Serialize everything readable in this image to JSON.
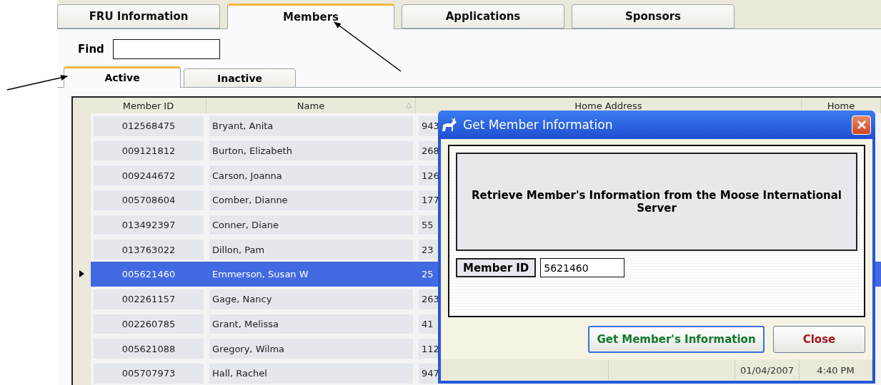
{
  "main_tabs": [
    {
      "label": "FRU Information",
      "selected": false
    },
    {
      "label": "Members",
      "selected": true
    },
    {
      "label": "Applications",
      "selected": false
    },
    {
      "label": "Sponsors",
      "selected": false
    }
  ],
  "find": {
    "label": "Find"
  },
  "sub_tabs": [
    {
      "label": "Active",
      "selected": true
    },
    {
      "label": "Inactive",
      "selected": false
    }
  ],
  "table": {
    "columns": [
      {
        "label": "Member ID",
        "sorted": false
      },
      {
        "label": "Name",
        "sorted": true
      },
      {
        "label": "Home Address",
        "sorted": false
      },
      {
        "label": "Home",
        "sorted": false
      }
    ],
    "rows": [
      {
        "member_id": "012568475",
        "name": "Bryant, Anita",
        "address": "943",
        "selected": false
      },
      {
        "member_id": "009121812",
        "name": "Burton, Elizabeth",
        "address": "268",
        "selected": false
      },
      {
        "member_id": "009244672",
        "name": "Carson, Joanna",
        "address": "126",
        "selected": false
      },
      {
        "member_id": "005708604",
        "name": "Comber, Dianne",
        "address": "177",
        "selected": false
      },
      {
        "member_id": "013492397",
        "name": "Conner, Diane",
        "address": "55",
        "selected": false
      },
      {
        "member_id": "013763022",
        "name": "Dillon, Pam",
        "address": "23",
        "selected": false
      },
      {
        "member_id": "005621460",
        "name": "Emmerson, Susan W",
        "address": "25",
        "selected": true
      },
      {
        "member_id": "002261157",
        "name": "Gage, Nancy",
        "address": "263",
        "selected": false
      },
      {
        "member_id": "002260785",
        "name": "Grant, Melissa",
        "address": "41",
        "selected": false
      },
      {
        "member_id": "005621088",
        "name": "Gregory, Wilma",
        "address": "112",
        "selected": false
      },
      {
        "member_id": "005707973",
        "name": "Hall, Rachel",
        "address": "947",
        "selected": false
      }
    ]
  },
  "dialog": {
    "title": "Get Member Information",
    "message": "Retrieve Member's Information from the Moose International Server",
    "field": {
      "label": "Member ID",
      "value": "5621460"
    },
    "buttons": [
      {
        "label": "Get Member's Information",
        "kind": "primary"
      },
      {
        "label": "Close",
        "kind": "cancel"
      }
    ],
    "status_bar": [
      "01/04/2007",
      "4:40 PM"
    ]
  }
}
